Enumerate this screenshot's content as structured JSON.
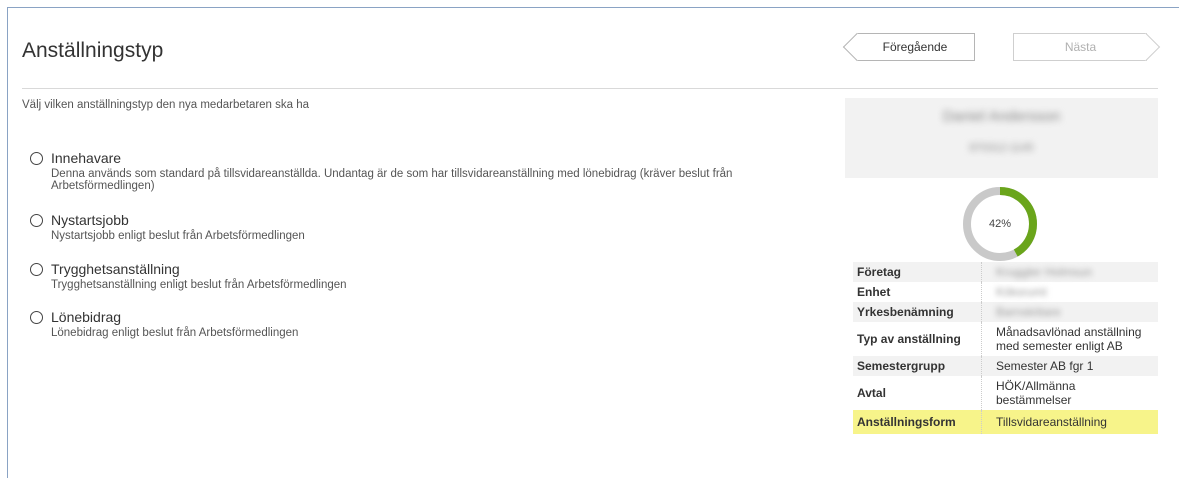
{
  "header": {
    "title": "Anställningstyp",
    "prev_label": "Föregående",
    "next_label": "Nästa"
  },
  "instruction": "Välj vilken anställningstyp den nya medarbetaren ska ha",
  "options": [
    {
      "label": "Innehavare",
      "desc": "Denna används som standard på tillsvidareanställda. Undantag är de som har tillsvidareanställning med lönebidrag (kräver beslut från Arbetsförmedlingen)"
    },
    {
      "label": "Nystartsjobb",
      "desc": "Nystartsjobb enligt beslut från Arbetsförmedlingen"
    },
    {
      "label": "Trygghetsanställning",
      "desc": "Trygghetsanställning enligt beslut från Arbetsförmedlingen"
    },
    {
      "label": "Lönebidrag",
      "desc": "Lönebidrag enligt beslut från Arbetsförmedlingen"
    }
  ],
  "employee": {
    "name": "Daniel Andersson",
    "id": "870312-1145"
  },
  "progress": {
    "percent": 42,
    "label": "42%",
    "color": "#6aa51b",
    "track_color": "#c9c9c9"
  },
  "info_rows": [
    {
      "key": "Företag",
      "value": "Kruggler Holmsun"
    },
    {
      "key": "Enhet",
      "value": "Köksrumt"
    },
    {
      "key": "Yrkesbenämning",
      "value": "Barnskötare"
    },
    {
      "key": "Typ av anställning",
      "value": "Månadsavlönad anställning med semester enligt AB"
    },
    {
      "key": "Semestergrupp",
      "value": "Semester AB fgr 1"
    },
    {
      "key": "Avtal",
      "value": "HÖK/Allmänna bestämmelser"
    },
    {
      "key": "Anställningsform",
      "value": "Tillsvidareanställning"
    }
  ],
  "highlight_color": "#f7f48a"
}
